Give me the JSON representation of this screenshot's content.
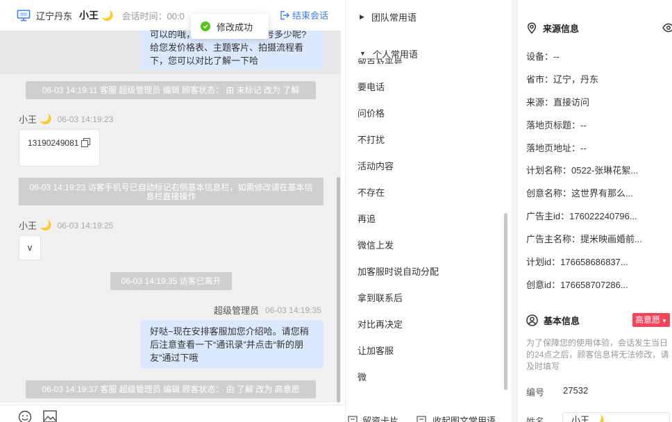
{
  "header": {
    "location": "辽宁丹东",
    "visitor_name": "小王",
    "visitor_emoji": "🌙",
    "session_time_label": "会话时间：00:0",
    "hidden_action": "",
    "end_session_label": "结束会话"
  },
  "toast": {
    "text": "修改成功"
  },
  "messages": {
    "bubble1_lines": [
      "可以的哦，",
      "号多少呢?",
      "给您发价格表、主题客片、拍摄流程看",
      "下，您可以对比了解一下哈"
    ],
    "sys1": "06-03 14:19:11 客服 超级管理员 编辑 顾客状态： 由 未标记 改为 了解",
    "sender1": "小王",
    "ts1": "06-03 14:19:23",
    "phone_msg": "13190249081",
    "sys2": "06-03 14:19:23 访客手机号已自动标记右侧基本信息栏，如需修改请在基本信息栏直接操作",
    "sender2": "小王",
    "ts2": "06-03 14:19:25",
    "v_msg": "v",
    "sys3": "06-03 14:19:35 访客已离开",
    "agent": "超级管理员",
    "ts3": "06-03 14:19:35",
    "bubble2_lines": [
      "好哒~现在安排客服加您介绍哈。请您稍",
      "后注意查看一下“通讯录”并点击“新的朋",
      "友”通过下哦"
    ],
    "sys4": "06-03 14:19:37 客服 超级管理员 编辑 顾客状态： 由 了解 改为 高意愿"
  },
  "phrases": {
    "team_group": "团队常用语",
    "personal_group": "个人常用语",
    "partial_item": "留百及平号",
    "items": [
      "要电话",
      "问价格",
      "不打扰",
      "活动内容",
      "不存在",
      "再追",
      "微信上发",
      "加客服时说自动分配",
      "拿到联系后",
      "对比再决定",
      "让加客服",
      "微"
    ],
    "footer_card": "留资卡片",
    "footer_collapse": "收起图文常用语"
  },
  "source": {
    "title": "来源信息",
    "fields": [
      {
        "label": "设备：",
        "value": "--"
      },
      {
        "label": "省市：",
        "value": "辽宁，丹东"
      },
      {
        "label": "来源：",
        "value": "直接访问"
      },
      {
        "label": "落地页标题：",
        "value": "--"
      },
      {
        "label": "落地页地址：",
        "value": "--"
      },
      {
        "label": "计划名称：",
        "value": "0522-张琳花絮..."
      },
      {
        "label": "创意名称：",
        "value": "这世界有那么..."
      },
      {
        "label": "广告主id：",
        "value": "176022240796..."
      },
      {
        "label": "广告主名称：",
        "value": "提米映画婚前..."
      },
      {
        "label": "计划id：",
        "value": "176658686837..."
      },
      {
        "label": "创意id：",
        "value": "176658707286..."
      }
    ]
  },
  "basic": {
    "title": "基本信息",
    "intent_badge": "高意愿",
    "note": "为了保障您的使用体验，会话发生当日的24点之后，顾客信息将无法修改，请及时填写",
    "id_label": "编号",
    "id_value": "27532",
    "name_label": "姓名",
    "name_value": "小王",
    "name_emoji": "🌙"
  },
  "colors": {
    "accent": "#3d7bfa",
    "bubble": "#dbe8fd",
    "system_msg": "#cfcfcf",
    "badge": "#f5455b",
    "success": "#52c41a"
  }
}
